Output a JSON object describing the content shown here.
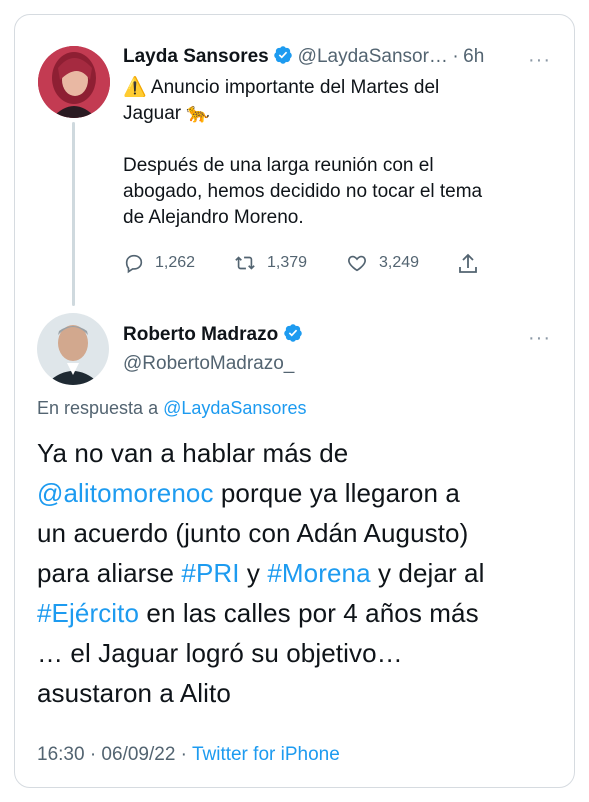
{
  "colors": {
    "accent": "#1d9bf0",
    "muted": "#536471",
    "border": "#d6dbe0",
    "thread": "#cfd9de"
  },
  "tweet1": {
    "author": "Layda Sansores",
    "handle": "@LaydaSansor…",
    "separator": "·",
    "time": "6h",
    "line1": "Anuncio importante del Martes del",
    "line2": "Jaguar",
    "emoji_warning": "⚠️",
    "emoji_jaguar": "🐆",
    "para_line1": "Después de una larga reunión con el",
    "para_line2": "abogado, hemos decidido no tocar el tema",
    "para_line3": "de Alejandro Moreno.",
    "replies": "1,262",
    "retweets": "1,379",
    "likes": "3,249",
    "icons": [
      "reply-icon",
      "retweet-icon",
      "like-icon",
      "share-icon"
    ]
  },
  "tweet2": {
    "author": "Roberto Madrazo",
    "handle": "@RobertoMadrazo_",
    "reply_prefix": "En respuesta a",
    "reply_to": "@LaydaSansores",
    "t1": "Ya no van a hablar más de",
    "mention": "@alitomorenoc",
    "t2": " porque ya llegaron a",
    "t3": "un acuerdo (junto con Adán Augusto)",
    "t4": "para aliarse ",
    "hashtag_pri": "#PRI",
    "t5": " y ",
    "hashtag_morena": "#Morena",
    "t6": " y dejar al",
    "hashtag_ejercito": "#Ejército",
    "t7": " en las calles por 4 años más",
    "t8": "… el Jaguar logró su objetivo…",
    "t9": "asustaron a Alito",
    "footer_time": "16:30 · 06/09/22 ·",
    "footer_source": "Twitter for iPhone"
  }
}
